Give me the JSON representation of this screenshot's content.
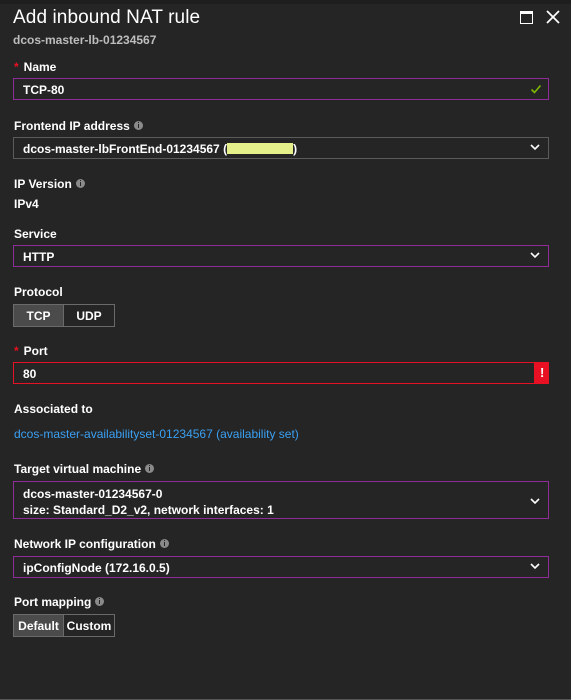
{
  "header": {
    "title": "Add inbound NAT rule",
    "subtitle": "dcos-master-lb-01234567",
    "maximize_icon": "maximize-icon",
    "close_icon": "close-icon"
  },
  "form": {
    "name": {
      "label": "Name",
      "required": true,
      "value": "TCP-80",
      "status_icon": "checkmark-icon"
    },
    "frontend_ip": {
      "label": "Frontend IP address",
      "value_prefix": "dcos-master-lbFrontEnd-01234567 (",
      "value_suffix": ")",
      "redacted": true
    },
    "ip_version": {
      "label": "IP Version",
      "value": "IPv4"
    },
    "service": {
      "label": "Service",
      "value": "HTTP"
    },
    "protocol": {
      "label": "Protocol",
      "options": [
        "TCP",
        "UDP"
      ],
      "selected": "TCP"
    },
    "port": {
      "label": "Port",
      "required": true,
      "value": "80",
      "error_icon": "!"
    },
    "associated_to": {
      "label": "Associated to",
      "link": "dcos-master-availabilityset-01234567 (availability set)"
    },
    "target_vm": {
      "label": "Target virtual machine",
      "line1": "dcos-master-01234567-0",
      "line2": "size: Standard_D2_v2, network interfaces: 1"
    },
    "network_ip_config": {
      "label": "Network IP configuration",
      "value": "ipConfigNode (172.16.0.5)"
    },
    "port_mapping": {
      "label": "Port mapping",
      "options": [
        "Default",
        "Custom"
      ],
      "selected": "Default"
    }
  },
  "colors": {
    "background": "#252525",
    "focus_border": "#8e2d96",
    "error": "#e81123",
    "link": "#3aa0f3",
    "valid": "#7fba00"
  }
}
